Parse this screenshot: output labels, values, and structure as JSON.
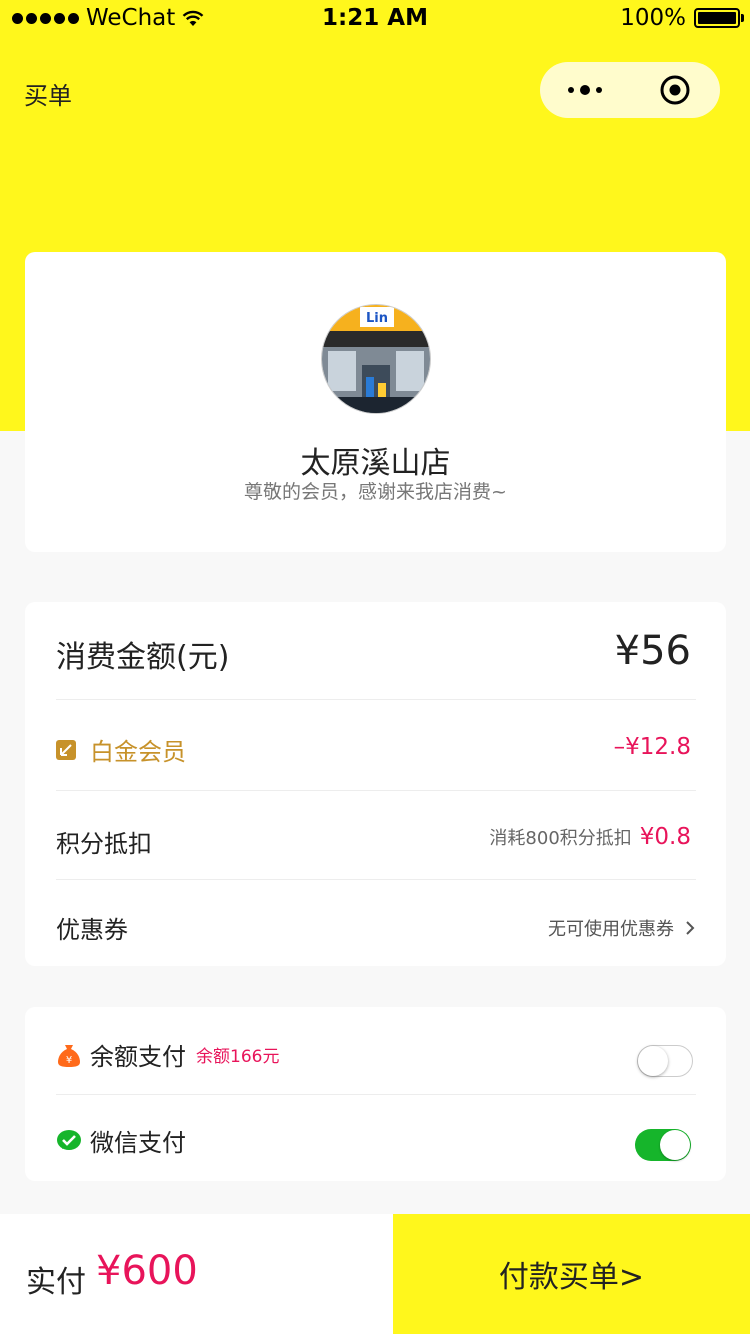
{
  "status_bar": {
    "carrier": "WeChat",
    "time": "1:21 AM",
    "battery": "100%"
  },
  "nav": {
    "title": "买单",
    "menu_icon": "more-dots-icon",
    "close_icon": "close-target-icon"
  },
  "store": {
    "name": "太原溪山店",
    "subtitle": "尊敬的会员，感谢来我店消费~",
    "avatar_sign_text": "Lin"
  },
  "amount": {
    "label": "消费金额(元)",
    "value": "¥56",
    "member_label": "白金会员",
    "member_discount": "–¥12.8",
    "points_label": "积分抵扣",
    "points_note": "消耗800积分抵扣",
    "points_value": "¥0.8",
    "coupon_label": "优惠券",
    "coupon_status": "无可使用优惠券"
  },
  "payment": {
    "balance_label": "余额支付",
    "balance_note": "余额166元",
    "balance_enabled": false,
    "wechat_label": "微信支付",
    "wechat_enabled": true
  },
  "bottom": {
    "paid_label": "实付",
    "paid_amount": "¥600",
    "pay_button": "付款买单>"
  },
  "colors": {
    "brand_yellow": "#fff71c",
    "accent_red": "#e8145a",
    "member_gold": "#c7922a",
    "wechat_green": "#16b52b",
    "balance_orange": "#ff6a1a"
  }
}
